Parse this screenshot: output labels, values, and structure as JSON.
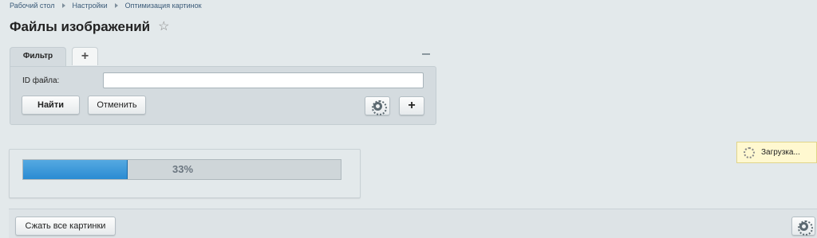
{
  "breadcrumb": {
    "items": [
      "Рабочий стол",
      "Настройки",
      "Оптимизация картинок"
    ]
  },
  "page": {
    "title": "Файлы изображений"
  },
  "filter": {
    "tab_label": "Фильтр",
    "add_tab_symbol": "+",
    "id_label": "ID файла:",
    "id_value": "",
    "find_label": "Найти",
    "cancel_label": "Отменить",
    "add_symbol": "+"
  },
  "progress": {
    "percent": 33,
    "label": "33%"
  },
  "loading": {
    "label": "Загрузка..."
  },
  "bottom": {
    "compress_label": "Сжать все картинки"
  },
  "colors": {
    "progress_fill": "#2a8bd2",
    "background": "#e3e9eb",
    "loading_bg": "#fff8d0"
  },
  "icons": [
    "star-icon",
    "gear-icon",
    "plus-icon",
    "minimize-icon",
    "spinner-icon"
  ]
}
